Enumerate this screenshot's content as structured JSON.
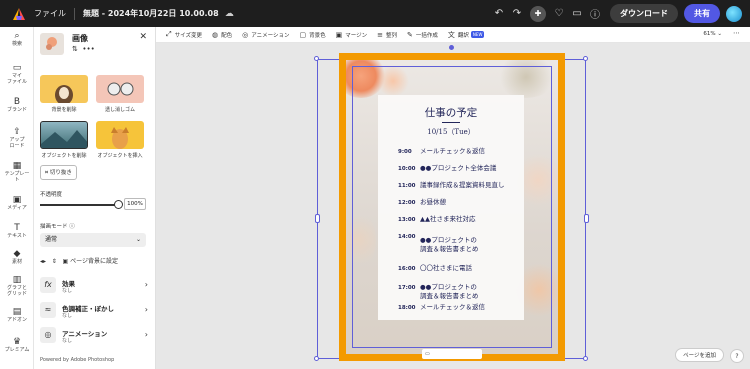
{
  "app": {
    "menu_file": "ファイル",
    "doc_title": "無題 - 2024年10月22日 10.00.08",
    "download": "ダウンロード",
    "share": "共有"
  },
  "rail": [
    {
      "icon": "⌕",
      "label": "検索"
    },
    {
      "icon": "▭",
      "label": "マイ\nファイル"
    },
    {
      "icon": "B",
      "label": "ブランド"
    },
    {
      "icon": "⇪",
      "label": "アップ\nロード"
    },
    {
      "icon": "▦",
      "label": "テンプレー\nト"
    },
    {
      "icon": "▣",
      "label": "メディア"
    },
    {
      "icon": "T",
      "label": "テキスト"
    },
    {
      "icon": "◆",
      "label": "素材"
    },
    {
      "icon": "▥",
      "label": "グラフと\nグリッド"
    },
    {
      "icon": "▤",
      "label": "アドオン"
    },
    {
      "icon": "♛",
      "label": "プレミアム"
    }
  ],
  "panel": {
    "title": "画像",
    "tiles": [
      {
        "label": "背景を削除"
      },
      {
        "label": "透し消しゴム"
      },
      {
        "label": "オブジェクトを削除"
      },
      {
        "label": "オブジェクトを挿入"
      }
    ],
    "cutout": "切り抜き",
    "opacity_label": "不透明度",
    "opacity_value": "100%",
    "blend_label": "描画モード",
    "blend_value": "通常",
    "set_background": "ページ背景に設定",
    "accordion": [
      {
        "icon": "fx",
        "title": "効果",
        "sub": "なし"
      },
      {
        "icon": "≈",
        "title": "色調補正・ぼかし",
        "sub": "なし"
      },
      {
        "icon": "◎",
        "title": "アニメーション",
        "sub": "なし"
      }
    ],
    "powered": "Powered by Adobe Photoshop"
  },
  "toolbar": {
    "items": [
      {
        "icon": "⤢",
        "label": "サイズ変更"
      },
      {
        "icon": "◍",
        "label": "配色"
      },
      {
        "icon": "◎",
        "label": "アニメーション"
      },
      {
        "icon": "▢",
        "label": "背景色"
      },
      {
        "icon": "▣",
        "label": "マージン"
      },
      {
        "icon": "≡",
        "label": "整列"
      },
      {
        "icon": "✎",
        "label": "一括作成"
      },
      {
        "icon": "文",
        "label": "翻訳"
      }
    ],
    "new_badge": "NEW",
    "zoom": "61%"
  },
  "document": {
    "title": "仕事の予定",
    "date": "10/15（Tue）",
    "schedule": [
      {
        "time": "9:00",
        "text": "メールチェック＆返信"
      },
      {
        "time": "10:00",
        "text": "●●プロジェクト全体会議"
      },
      {
        "time": "11:00",
        "text": "議事録作成＆提案資料見直し"
      },
      {
        "time": "12:00",
        "text": "お昼休憩"
      },
      {
        "time": "13:00",
        "text": "▲▲社さま来社対応"
      },
      {
        "time": "14:00",
        "text": "●●プロジェクトの\n調査＆報告書まとめ"
      },
      {
        "time": "16:00",
        "text": "〇〇社さまに電話"
      },
      {
        "time": "17:00",
        "text": "●●プロジェクトの\n調査＆報告書まとめ"
      },
      {
        "time": "18:00",
        "text": "メールチェック＆返信"
      }
    ]
  },
  "canvas": {
    "add_page": "ページを追加",
    "help": "?"
  },
  "colors": {
    "accent": "#5258e4",
    "selection": "#5f5fd8",
    "highlight_frame": "#f39a00",
    "text_navy": "#23265a"
  }
}
